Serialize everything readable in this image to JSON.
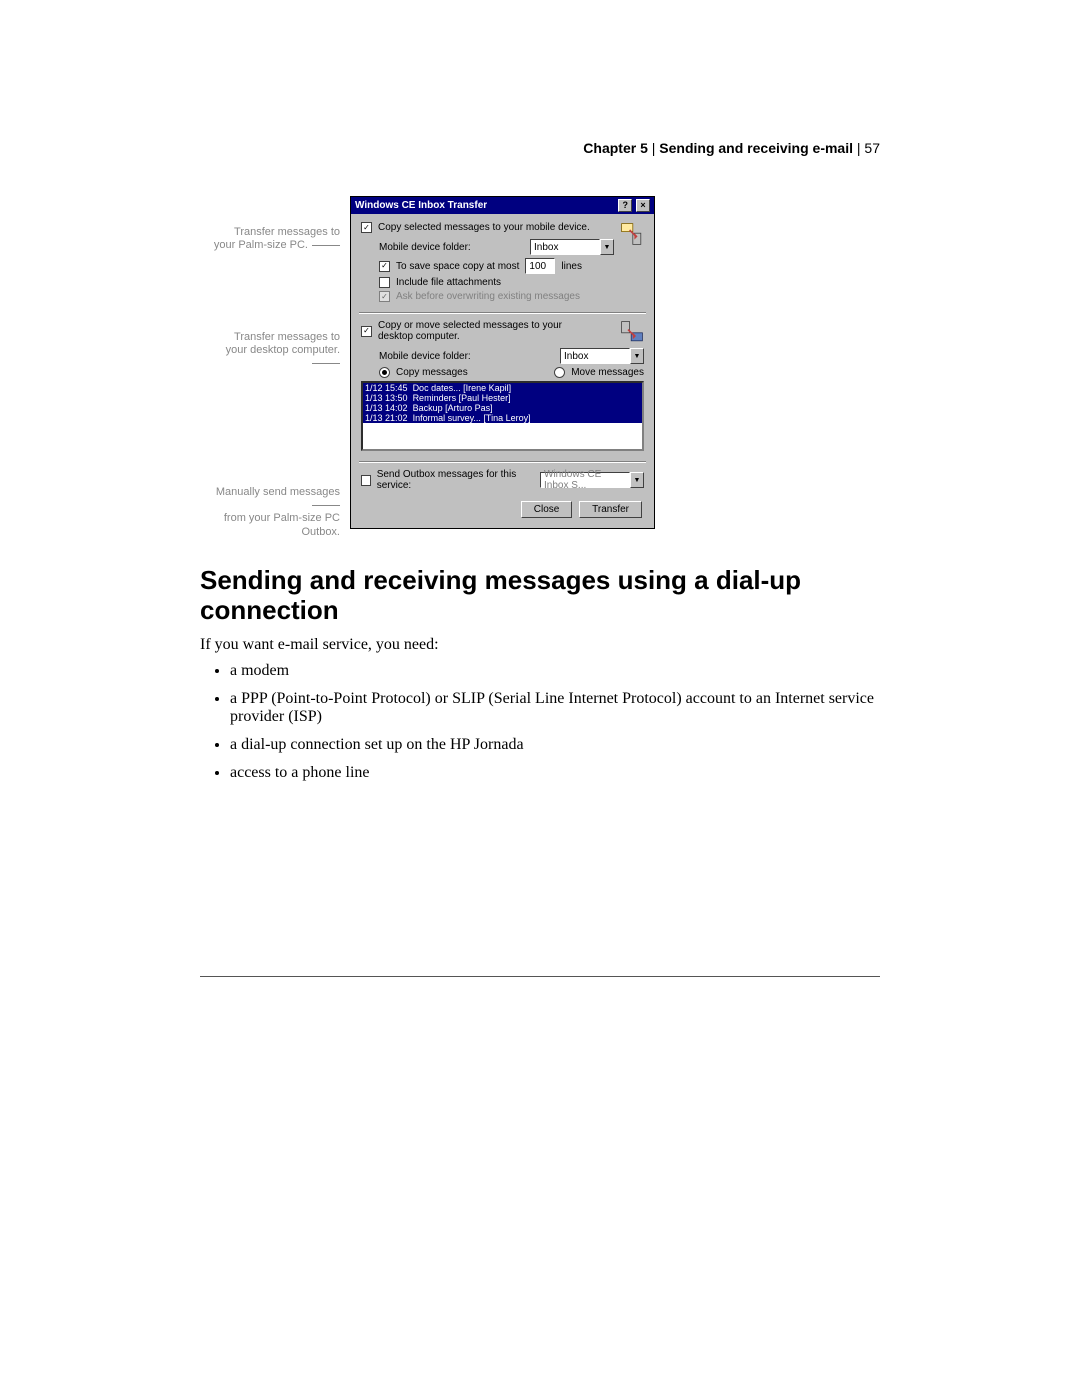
{
  "header": {
    "chapter": "Chapter 5",
    "title": "Sending and receiving e-mail",
    "page": "57",
    "sep": " | "
  },
  "callout1": {
    "l1": "Transfer messages to",
    "l2": "your Palm-size PC."
  },
  "callout2": {
    "l1": "Transfer messages to",
    "l2": "your desktop computer."
  },
  "callout3": {
    "l1": "Manually send messages",
    "l2": "from your Palm-size PC",
    "l3": "Outbox."
  },
  "dialog": {
    "title": "Windows CE Inbox Transfer",
    "section1": {
      "copySelected": "Copy selected messages to your mobile device.",
      "mobileFolder": "Mobile device folder:",
      "folderValue": "Inbox",
      "saveSpace": "To save space copy at most",
      "lines": "100",
      "linesUnit": "lines",
      "includeAttach": "Include file attachments",
      "overwrite": "Ask before overwriting existing messages"
    },
    "section2": {
      "copyMove": "Copy or move selected messages to your desktop computer.",
      "mobileFolder": "Mobile device folder:",
      "folderValue": "Inbox",
      "copy": "Copy messages",
      "move": "Move messages",
      "rows": [
        {
          "time": "1/12 15:45",
          "text": "Doc dates... [Irene Kapil]"
        },
        {
          "time": "1/13 13:50",
          "text": "Reminders [Paul Hester]"
        },
        {
          "time": "1/13 14:02",
          "text": "Backup [Arturo Pas]"
        },
        {
          "time": "1/13 21:02",
          "text": "Informal survey... [Tina Leroy]"
        }
      ]
    },
    "section3": {
      "send": "Send Outbox messages for this service:",
      "svc": "Windows CE Inbox S..."
    },
    "close": "Close",
    "transfer": "Transfer"
  },
  "heading": "Sending and receiving messages using a dial-up connection",
  "intro": "If you want e-mail service, you need:",
  "bullets": [
    "a modem",
    "a PPP (Point-to-Point Protocol) or SLIP (Serial Line Internet Protocol) account to an Internet service provider (ISP)",
    "a dial-up connection set up on the HP Jornada",
    "access to a phone line"
  ]
}
